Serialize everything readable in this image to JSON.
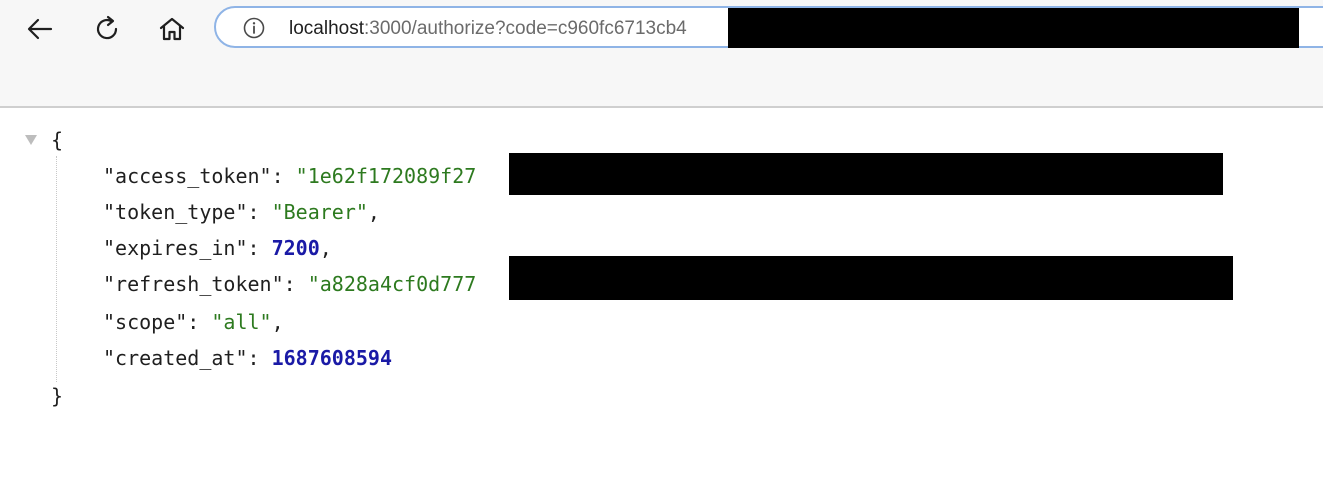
{
  "browser": {
    "url_host": "localhost",
    "url_rest": ":3000/authorize?code=c960fc6713cb4",
    "icons": {
      "back": "arrow-left-icon",
      "reload": "reload-icon",
      "home": "home-icon",
      "info": "info-icon"
    }
  },
  "json": {
    "open_brace": "{",
    "close_brace": "}",
    "rows": [
      {
        "key": "\"access_token\"",
        "sep": ": ",
        "value": "\"1e62f172089f27",
        "tail": "",
        "type": "string"
      },
      {
        "key": "\"token_type\"",
        "sep": ": ",
        "value": "\"Bearer\"",
        "tail": ",",
        "type": "string"
      },
      {
        "key": "\"expires_in\"",
        "sep": ": ",
        "value": "7200",
        "tail": ",",
        "type": "number"
      },
      {
        "key": "\"refresh_token\"",
        "sep": ": ",
        "value": "\"a828a4cf0d777",
        "tail": "",
        "type": "string"
      },
      {
        "key": "\"scope\"",
        "sep": ": ",
        "value": "\"all\"",
        "tail": ",",
        "type": "string"
      },
      {
        "key": "\"created_at\"",
        "sep": ": ",
        "value": "1687608594",
        "tail": "",
        "type": "number"
      }
    ]
  },
  "colors": {
    "string": "#2d7a1f",
    "number": "#1a1aa6",
    "address_border": "#8fb4e6",
    "toolbar_bg": "#f7f7f7"
  }
}
